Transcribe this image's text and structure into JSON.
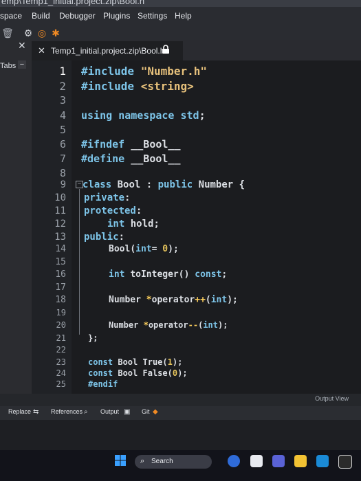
{
  "window": {
    "title": "emp\\Temp1_initial.project.zip\\Bool.h"
  },
  "menu": [
    "space",
    "Build",
    "Debugger",
    "Plugins",
    "Settings",
    "Help"
  ],
  "toolbar_icons": [
    "trash-icon",
    "gear-icon",
    "target-icon",
    "bug-icon"
  ],
  "sidebar": {
    "close_glyph": "✕",
    "tab_label": "Tabs",
    "collapse_glyph": "−"
  },
  "editor_tab": {
    "close_glyph": "✕",
    "title": "Temp1_initial.project.zip\\Bool.h",
    "icon": "lock-icon"
  },
  "code": {
    "active_line": 1,
    "lines": [
      "#include \"Number.h\"",
      "#include <string>",
      "",
      "using namespace std;",
      "",
      "#ifndef __Bool__",
      "#define __Bool__",
      "",
      "class Bool : public Number {",
      "private:",
      "protected:",
      "    int hold;",
      "public:",
      "    Bool(int= 0);",
      "",
      "    int toInteger() const;",
      "",
      "    Number *operator++(int);",
      "",
      "    Number *operator--(int);",
      "};",
      "",
      "const Bool True(1);",
      "const Bool False(0);",
      "#endif"
    ],
    "fold_glyph": "−"
  },
  "bottom_panel": {
    "output_view_label": "Output View",
    "tabs": [
      "Replace",
      "References",
      "Output",
      "Git"
    ]
  },
  "taskbar": {
    "search_label": "Search",
    "apps": [
      "windows-start-icon",
      "copilot-icon",
      "task-view-icon",
      "chat-icon",
      "file-explorer-icon",
      "mail-icon",
      "epic-games-icon"
    ]
  },
  "colors": {
    "keyword": "#7dc4e8",
    "string": "#e6c07b",
    "number": "#e5c35c",
    "operator": "#ffd15c",
    "default_text": "#dcdfe4",
    "line_number": "#9aa0a8",
    "editor_bg": "#1b1c1f"
  }
}
